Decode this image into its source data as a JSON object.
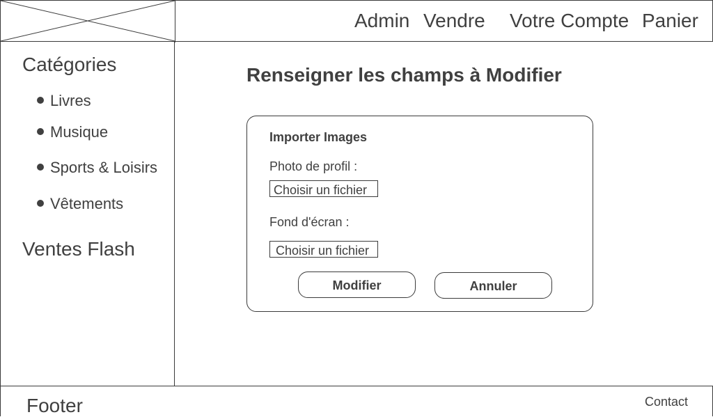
{
  "header": {
    "nav": [
      {
        "label": "Admin"
      },
      {
        "label": "Vendre"
      },
      {
        "label": "Votre Compte"
      },
      {
        "label": "Panier"
      }
    ]
  },
  "sidebar": {
    "categories_heading": "Catégories",
    "categories": [
      {
        "label": "Livres"
      },
      {
        "label": "Musique"
      },
      {
        "label": "Sports & Loisirs"
      },
      {
        "label": "Vêtements"
      }
    ],
    "flash_sales": "Ventes Flash"
  },
  "main": {
    "title": "Renseigner les champs à Modifier",
    "form": {
      "section_title": "Importer Images",
      "profile_photo_label": "Photo de profil :",
      "profile_photo_button": "Choisir un fichier",
      "background_label": "Fond d'écran :",
      "background_button": "Choisir un fichier",
      "submit_label": "Modifier",
      "cancel_label": "Annuler"
    }
  },
  "footer": {
    "label": "Footer",
    "contact": "Contact"
  }
}
